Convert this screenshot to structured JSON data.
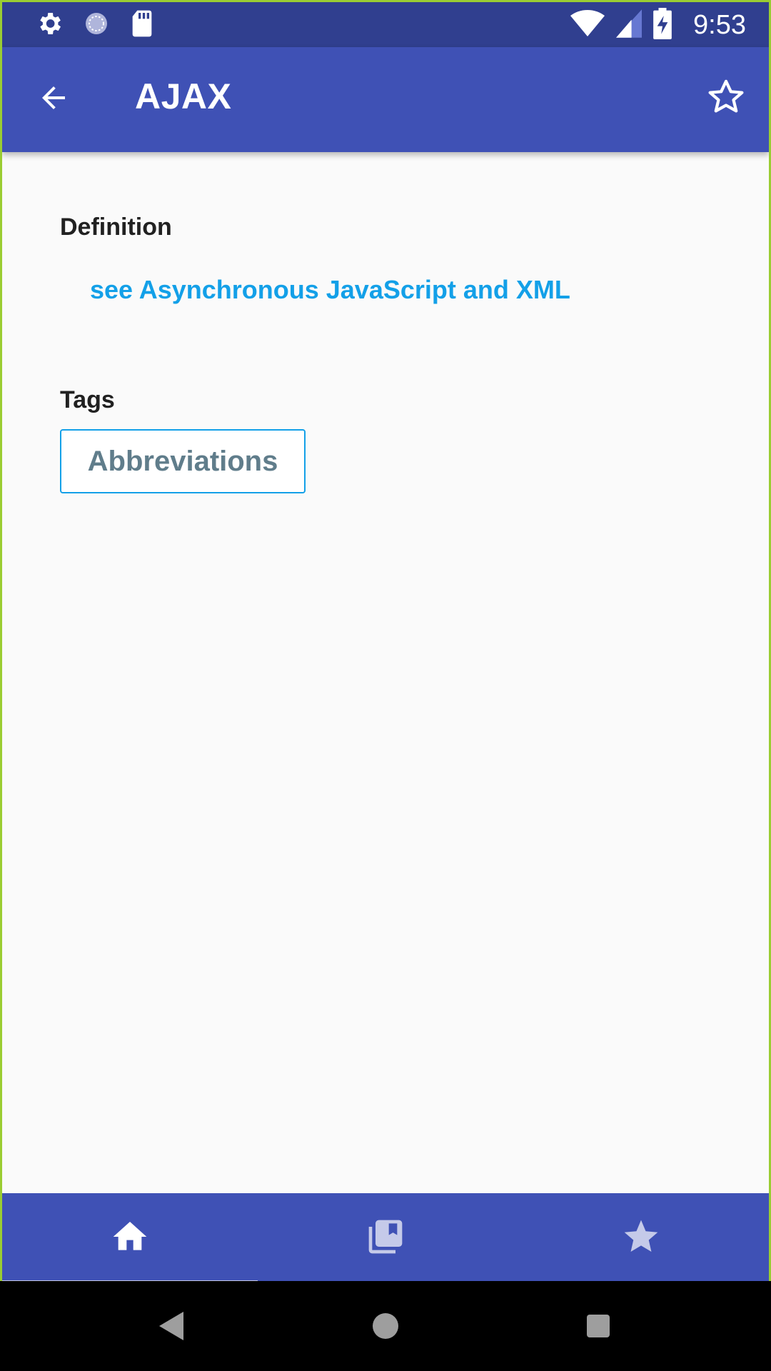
{
  "status_bar": {
    "time": "9:53",
    "left_icons": [
      "settings-icon",
      "sync-icon",
      "sd-card-icon"
    ],
    "right_icons": [
      "wifi-icon",
      "signal-icon",
      "battery-charging-icon"
    ]
  },
  "app_bar": {
    "title": "AJAX",
    "back_icon": "arrow-back-icon",
    "favorite_icon": "star-outline-icon"
  },
  "definition": {
    "heading": "Definition",
    "link_text": "see Asynchronous JavaScript and XML"
  },
  "tags": {
    "heading": "Tags",
    "items": [
      {
        "label": "Abbreviations"
      }
    ]
  },
  "bottom_nav": {
    "items": [
      {
        "icon": "home-icon",
        "selected": true
      },
      {
        "icon": "library-books-icon",
        "selected": false
      },
      {
        "icon": "star-icon",
        "selected": false
      }
    ]
  },
  "colors": {
    "status_bar": "#303f8f",
    "primary": "#3f51b5",
    "link": "#13a0e8",
    "chip_text": "#607d8b",
    "background": "#fafafa"
  }
}
